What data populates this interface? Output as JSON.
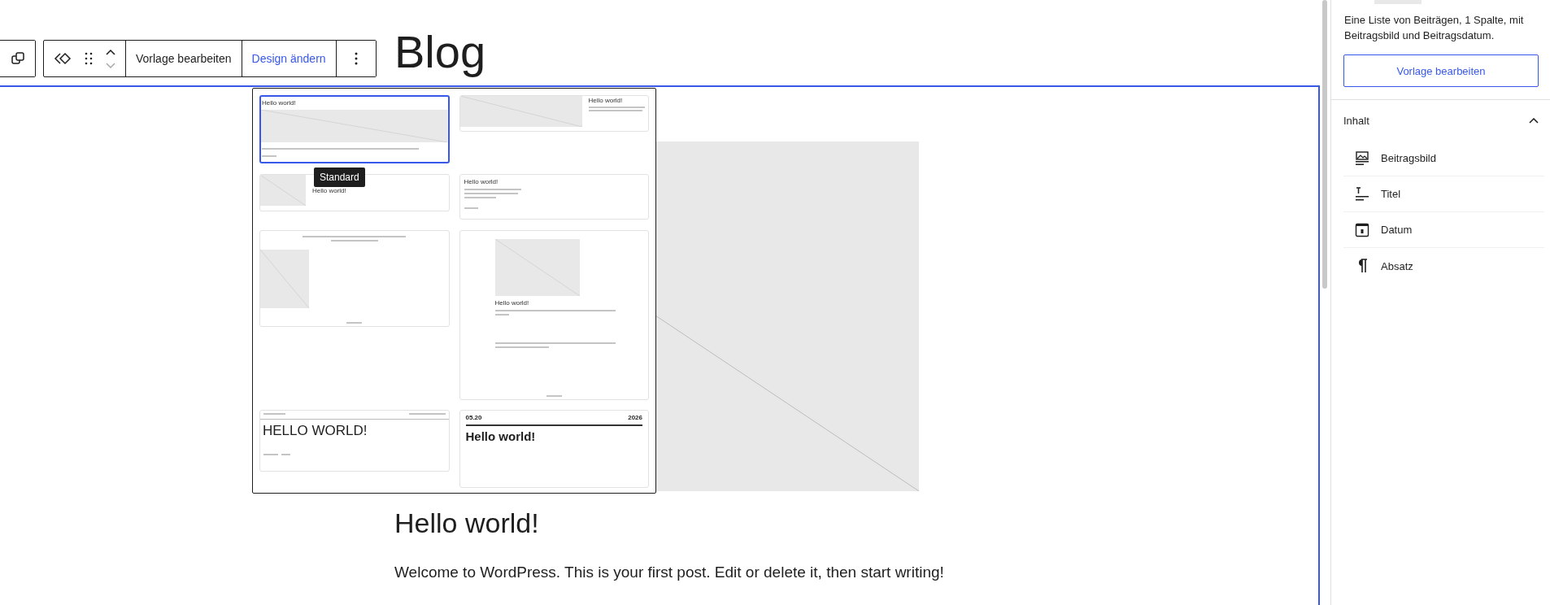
{
  "toolbar": {
    "edit_template": "Vorlage bearbeiten",
    "change_design": "Design ändern"
  },
  "page_title": "Blog",
  "design_popover": {
    "tooltip": "Standard",
    "patterns": [
      {
        "kind": "stacked",
        "selected": true,
        "title": "Hello world!"
      },
      {
        "kind": "wide",
        "selected": false,
        "title": "Hello world!"
      },
      {
        "kind": "thumb",
        "selected": false,
        "title": "Hello world!"
      },
      {
        "kind": "text",
        "selected": false,
        "title": "Hello world!"
      },
      {
        "kind": "grid",
        "selected": false
      },
      {
        "kind": "centered",
        "selected": false,
        "title": "Hello world!"
      },
      {
        "kind": "caps",
        "selected": false,
        "title": "HELLO WORLD!"
      },
      {
        "kind": "dated",
        "selected": false,
        "title": "Hello world!",
        "day": "05.20",
        "year": "2026"
      }
    ]
  },
  "post": {
    "title": "Hello world!",
    "excerpt": "Welcome to WordPress. This is your first post. Edit or delete it, then start writing!"
  },
  "sidebar": {
    "description": "Eine Liste von Beiträgen, 1 Spalte, mit Beitragsbild und Beitragsdatum.",
    "button": "Vorlage bearbeiten",
    "section": {
      "title": "Inhalt",
      "expanded": true,
      "items": [
        {
          "kind": "featured-image",
          "label": "Beitragsbild"
        },
        {
          "kind": "title",
          "label": "Titel"
        },
        {
          "kind": "date",
          "label": "Datum"
        },
        {
          "kind": "paragraph",
          "label": "Absatz"
        }
      ]
    }
  }
}
